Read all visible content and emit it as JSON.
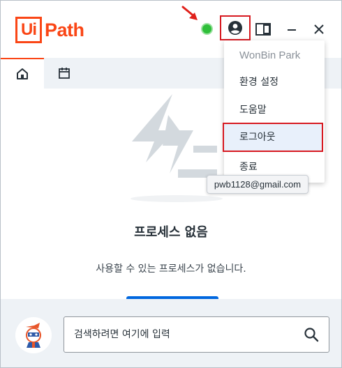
{
  "app": {
    "logo_box": "Ui",
    "logo_text": "Path"
  },
  "titlebar": {
    "status": "connected",
    "status_color": "#2fbf3a",
    "accent_color": "#fa4616",
    "highlight_color": "#d71920",
    "icons": [
      "status-dot-icon",
      "profile-icon",
      "side-panel-icon",
      "minimize-icon",
      "close-icon"
    ]
  },
  "tabs": [
    {
      "name": "home",
      "icon": "home-icon",
      "active": true
    },
    {
      "name": "calendar",
      "icon": "calendar-icon",
      "active": false
    }
  ],
  "main": {
    "empty_title": "프로세스 없음",
    "empty_subtitle": "사용할 수 있는 프로세스가 없습니다."
  },
  "search": {
    "placeholder": "검색하려면 여기에 입력"
  },
  "profile_menu": {
    "user_name": "WonBin Park",
    "settings": "환경 설정",
    "help": "도움말",
    "logout": "로그아웃",
    "exit": "종료",
    "email_tooltip": "pwb1128@gmail.com"
  }
}
